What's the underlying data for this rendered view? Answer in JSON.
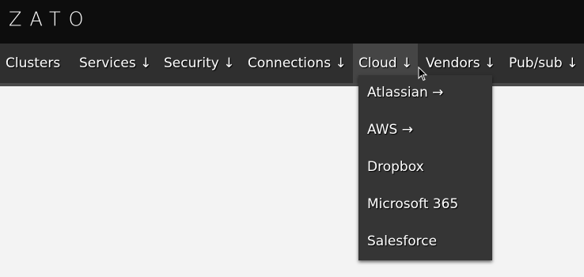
{
  "app": {
    "logo_text": "ZATO"
  },
  "nav": {
    "items": [
      {
        "label": "Clusters"
      },
      {
        "label": "Services ↓"
      },
      {
        "label": "Security ↓"
      },
      {
        "label": "Connections ↓"
      },
      {
        "label": "Cloud ↓"
      },
      {
        "label": "Vendors ↓"
      },
      {
        "label": "Pub/sub ↓"
      }
    ],
    "active_index": 4
  },
  "cloud_menu": {
    "items": [
      {
        "label": "Atlassian →"
      },
      {
        "label": "AWS →"
      },
      {
        "label": "Dropbox"
      },
      {
        "label": "Microsoft 365"
      },
      {
        "label": "Salesforce"
      }
    ]
  },
  "colors": {
    "topbar": "#0d0d0d",
    "navbar": "#2f2f2f",
    "active_nav": "#454545",
    "dropdown": "#353535",
    "page_background": "#f3f3f3",
    "text": "#ffffff"
  },
  "icons": {
    "cursor": "mouse-pointer-icon"
  }
}
